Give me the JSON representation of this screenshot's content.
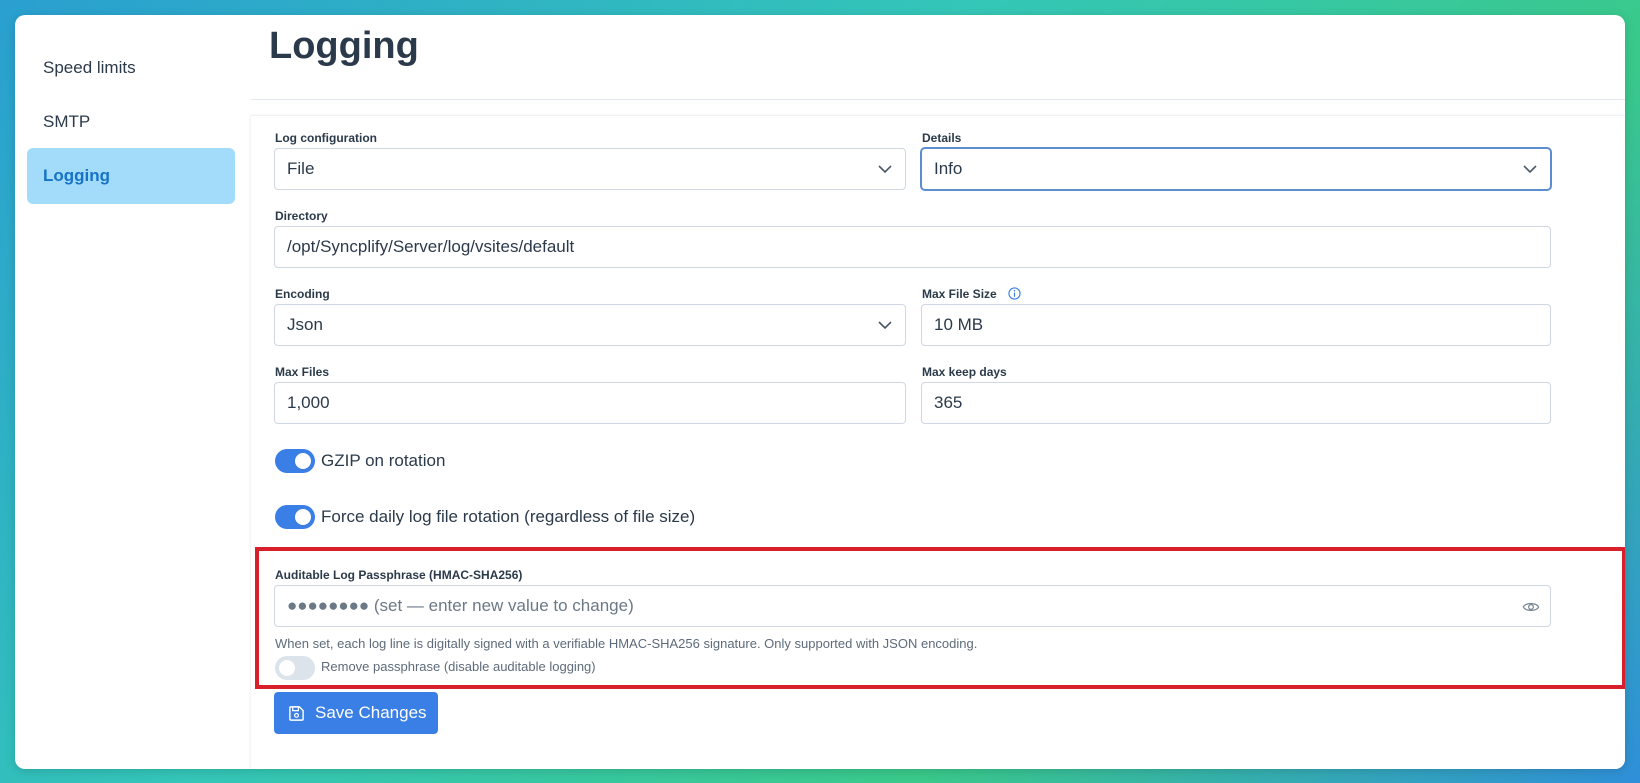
{
  "sidebar": {
    "items": [
      {
        "label": "Speed limits"
      },
      {
        "label": "SMTP"
      },
      {
        "label": "Logging",
        "active": true
      }
    ]
  },
  "page": {
    "title": "Logging"
  },
  "form": {
    "log_configuration": {
      "label": "Log configuration",
      "value": "File"
    },
    "details": {
      "label": "Details",
      "value": "Info"
    },
    "directory": {
      "label": "Directory",
      "value": "/opt/Syncplify/Server/log/vsites/default"
    },
    "encoding": {
      "label": "Encoding",
      "value": "Json"
    },
    "max_file_size": {
      "label": "Max File Size",
      "value": "10 MB",
      "icon": "info-icon"
    },
    "max_files": {
      "label": "Max Files",
      "value": "1,000"
    },
    "max_keep_days": {
      "label": "Max keep days",
      "value": "365"
    },
    "gzip": {
      "label": "GZIP on rotation",
      "on": true
    },
    "force_daily": {
      "label": "Force daily log file rotation (regardless of file size)",
      "on": true
    },
    "passphrase": {
      "label": "Auditable Log Passphrase (HMAC-SHA256)",
      "placeholder": "●●●●●●●● (set — enter new value to change)",
      "hint": "When set, each log line is digitally signed with a verifiable HMAC-SHA256 signature. Only supported with JSON encoding.",
      "remove_label": "Remove passphrase (disable auditable logging)",
      "remove_on": false
    },
    "save_label": "Save Changes"
  },
  "colors": {
    "accent": "#3a7fe6",
    "highlight": "#d81f2a",
    "active_bg": "#a2dcfa"
  }
}
